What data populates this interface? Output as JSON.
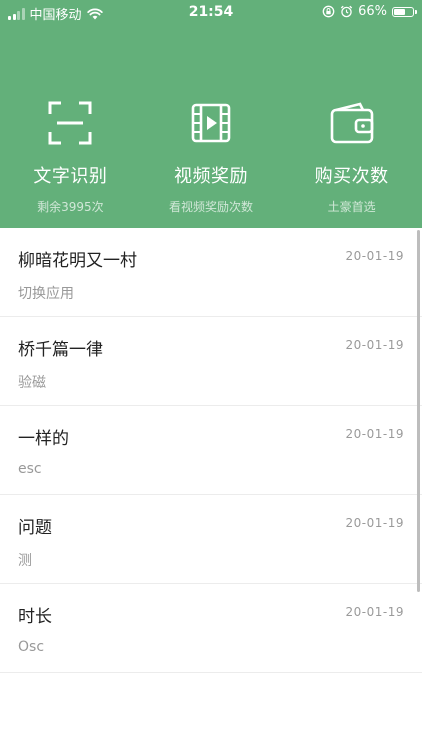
{
  "status_bar": {
    "carrier": "中国移动",
    "time": "21:54",
    "battery": "66%",
    "battery_level": 0.66
  },
  "features": [
    {
      "title": "文字识别",
      "subtitle": "剩余3995次",
      "icon": "scan-icon"
    },
    {
      "title": "视频奖励",
      "subtitle": "看视频奖励次数",
      "icon": "video-icon"
    },
    {
      "title": "购买次数",
      "subtitle": "土豪首选",
      "icon": "wallet-icon"
    }
  ],
  "list": [
    {
      "title": "柳暗花明又一村",
      "subtitle": "切换应用",
      "date": "20-01-19"
    },
    {
      "title": "桥千篇一律",
      "subtitle": "验磁",
      "date": "20-01-19"
    },
    {
      "title": "一样的",
      "subtitle": "esc",
      "date": "20-01-19"
    },
    {
      "title": "问题",
      "subtitle": "测",
      "date": "20-01-19"
    },
    {
      "title": "时长",
      "subtitle": "Osc",
      "date": "20-01-19"
    }
  ],
  "colors": {
    "header_bg": "#63b07a",
    "text_primary": "#222222",
    "text_secondary": "#999999"
  }
}
